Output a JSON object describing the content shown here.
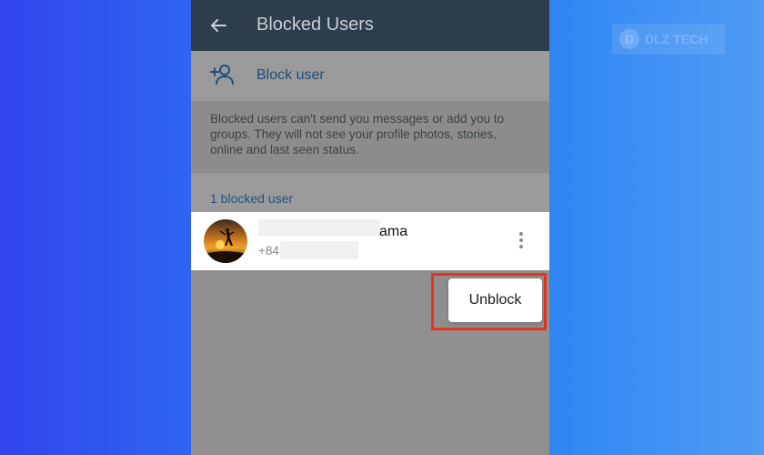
{
  "appbar": {
    "title": "Blocked Users"
  },
  "block_row": {
    "label": "Block user"
  },
  "info": {
    "text": "Blocked users can't send you messages or add you to groups. They will not see your profile photos, stories, online and last seen status."
  },
  "section": {
    "header": "1 blocked user"
  },
  "blocked_users": [
    {
      "name_suffix": "ama",
      "phone_prefix": "+84"
    }
  ],
  "context_menu": {
    "unblock_label": "Unblock"
  },
  "watermark": {
    "text": "DLZ TECH"
  },
  "icons": {
    "back": "arrow-left-icon",
    "add_user": "person-add-icon",
    "more": "vertical-dots-icon"
  },
  "colors": {
    "appbar": "#2e3d4c",
    "accent_link": "#1d4f7c",
    "highlight": "#e8341f"
  }
}
